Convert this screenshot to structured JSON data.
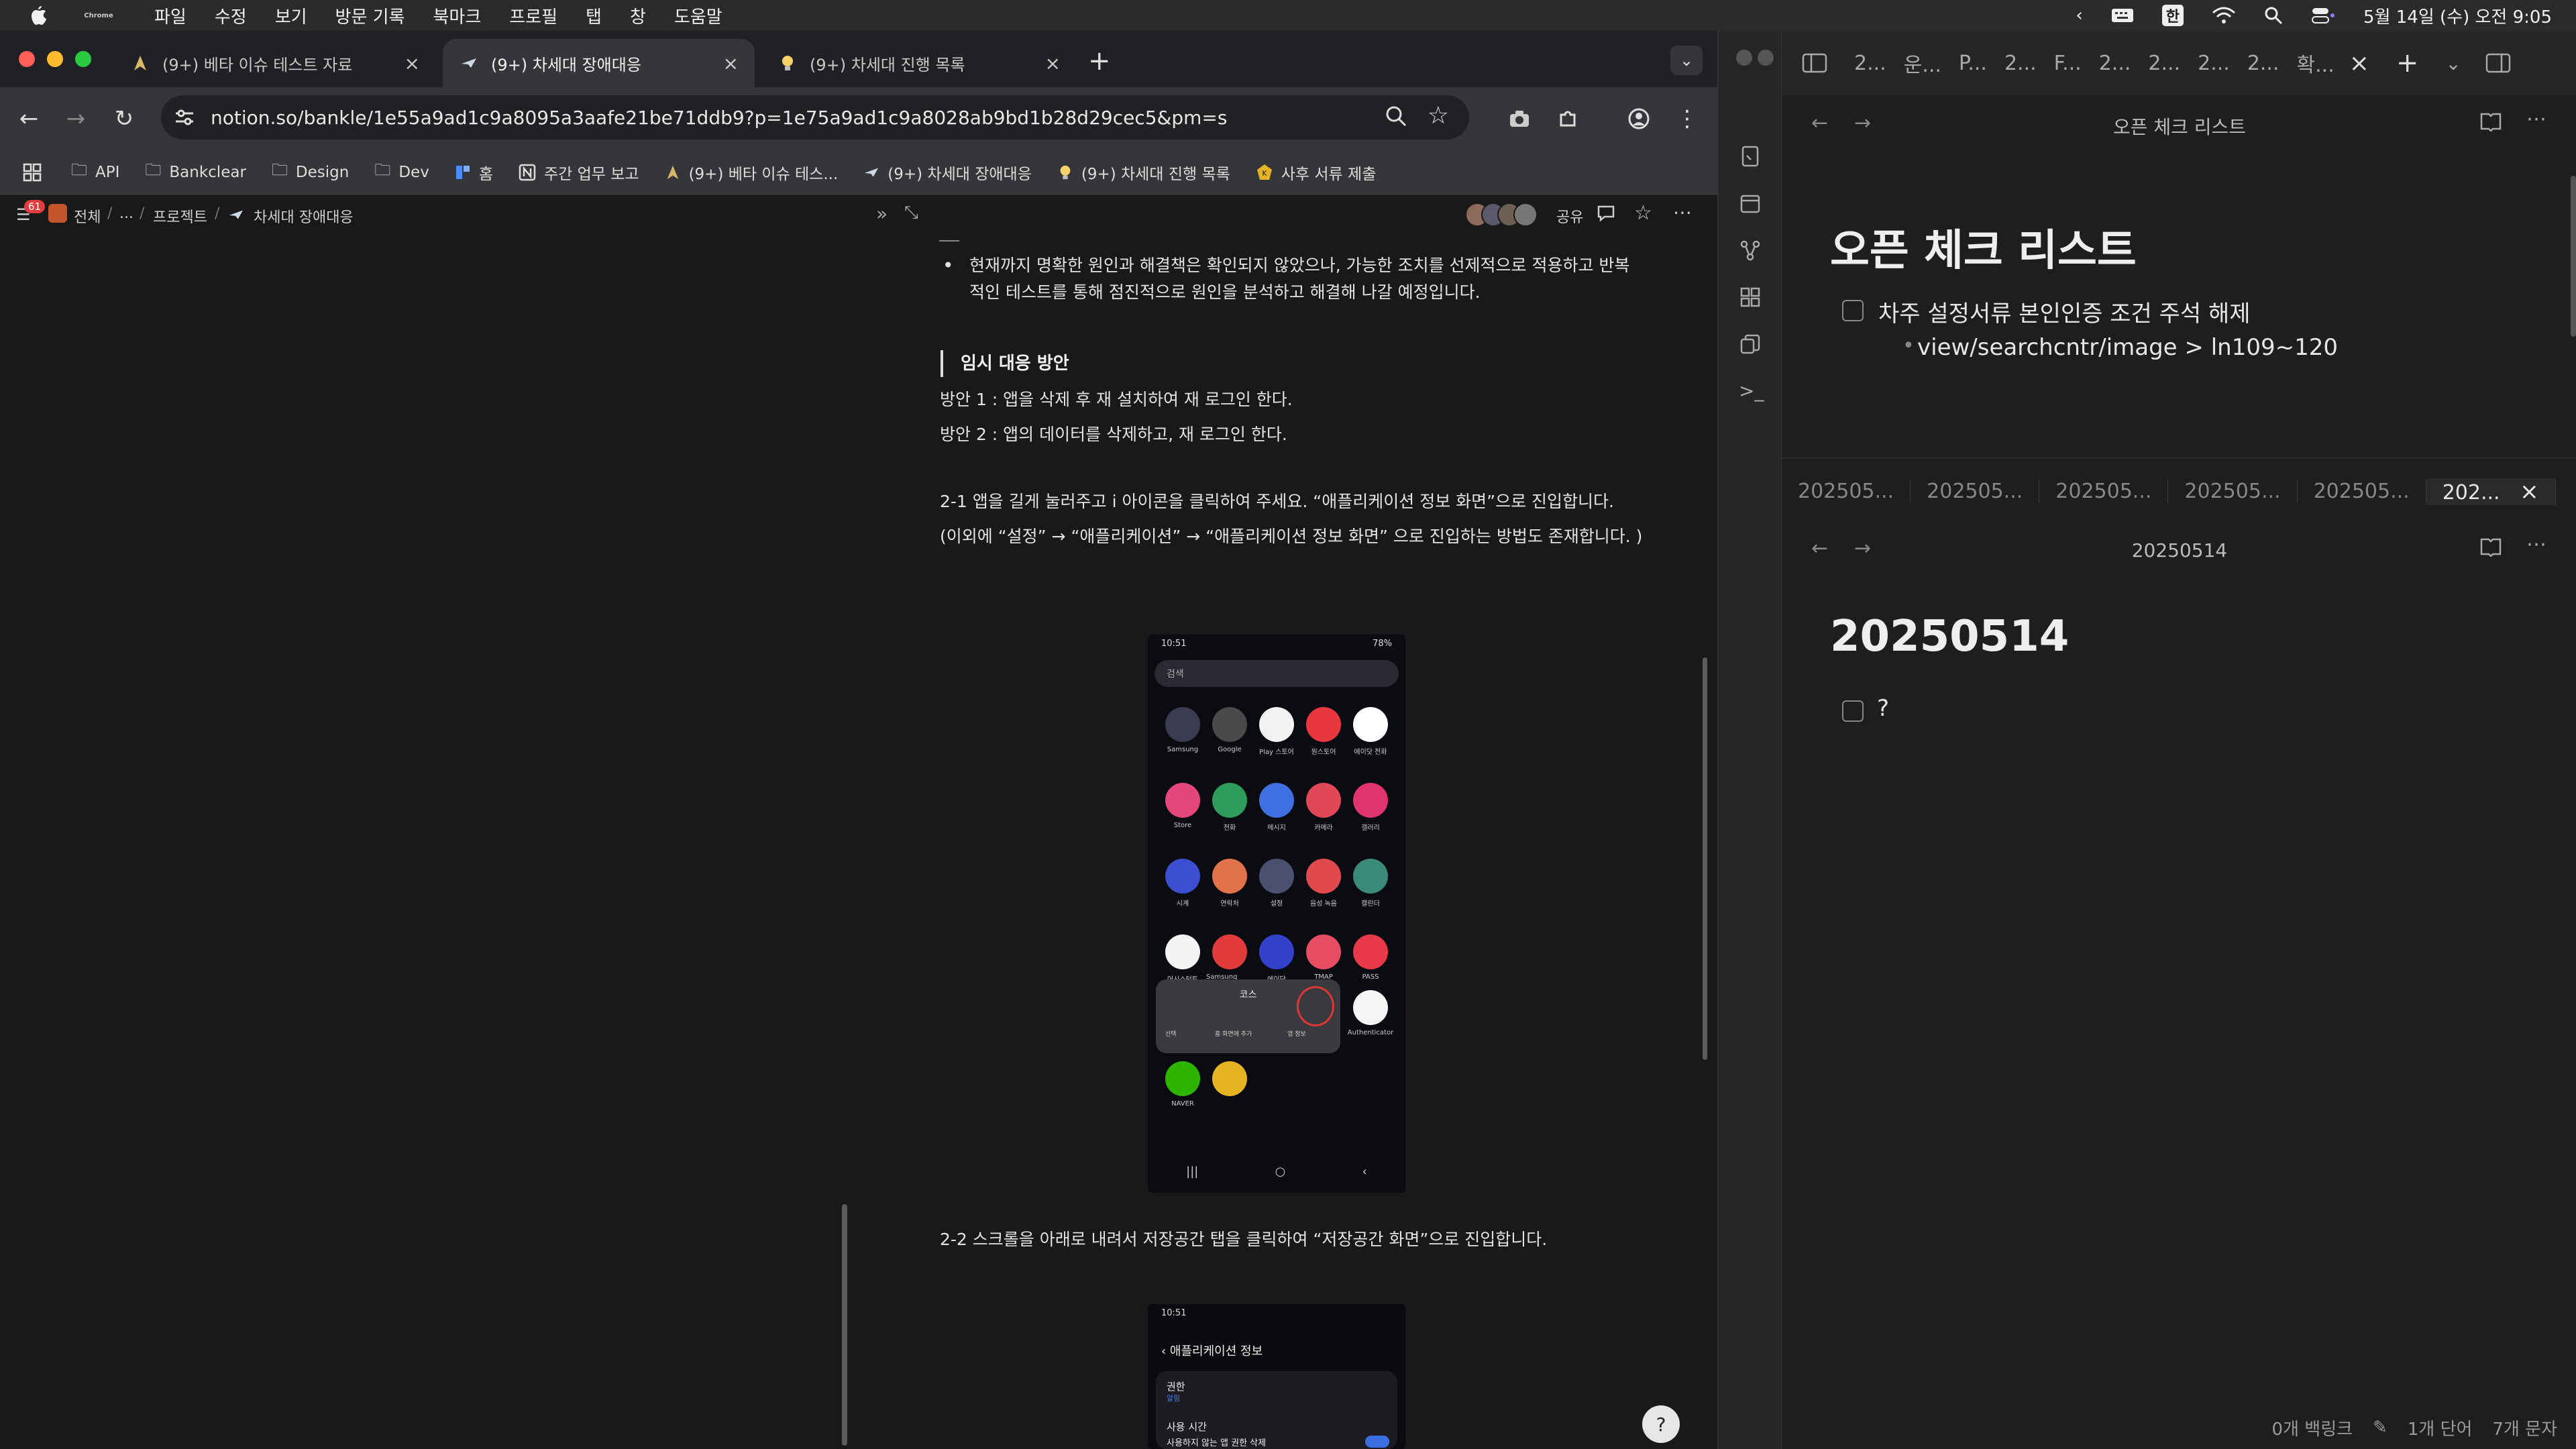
{
  "menubar": {
    "app": "Chrome",
    "items": [
      "파일",
      "수정",
      "보기",
      "방문 기록",
      "북마크",
      "프로필",
      "탭",
      "창",
      "도움말"
    ],
    "ime": "한",
    "datetime": "5월 14일 (수) 오전 9:05"
  },
  "chrome": {
    "tabs": [
      {
        "label": "(9+) 베타 이슈 테스트 자료",
        "icon": "person-icon",
        "active": false
      },
      {
        "label": "(9+) 차세대 장애대응",
        "icon": "plane-icon",
        "active": true
      },
      {
        "label": "(9+) 차세대 진행 목록",
        "icon": "bulb-icon",
        "active": false
      }
    ],
    "url": "notion.so/bankle/1e55a9ad1c9a8095a3aafe21be71ddb9?p=1e75a9ad1c9a8028ab9bd1b28d29cec5&pm=s",
    "bookmarks": [
      {
        "label": "API",
        "icon": "folder-icon"
      },
      {
        "label": "Bankclear",
        "icon": "folder-icon"
      },
      {
        "label": "Design",
        "icon": "folder-icon"
      },
      {
        "label": "Dev",
        "icon": "folder-icon"
      },
      {
        "label": "홈",
        "icon": "notion-blue-icon"
      },
      {
        "label": "주간 업무 보고",
        "icon": "notion-icon"
      },
      {
        "label": "(9+) 베타 이슈 테스...",
        "icon": "person-icon"
      },
      {
        "label": "(9+) 차세대 장애대응",
        "icon": "plane-icon"
      },
      {
        "label": "(9+) 차세대 진행 목록",
        "icon": "bulb-icon"
      },
      {
        "label": "사후 서류 제출",
        "icon": "badge-icon"
      }
    ]
  },
  "notion": {
    "breadcrumb": {
      "badge": "61",
      "items": [
        "전체",
        "...",
        "프로젝트",
        "차세대 장애대응"
      ]
    },
    "share_label": "공유",
    "bullet": "현재까지 명확한 원인과 해결책은 확인되지 않았으나, 가능한 조치를 선제적으로 적용하고 반복적인 테스트를 통해 점진적으로 원인을 분석하고 해결해 나갈 예정입니다.",
    "heading": "임시 대응 방안",
    "plan1": "방안 1 : 앱을 삭제 후 재 설치하여 재 로그인 한다.",
    "plan2": "방안 2 : 앱의 데이터를 삭제하고, 재 로그인 한다.",
    "step1": "2-1 앱을 길게 눌러주고 i 아이콘을 클릭하여 주세요. “애플리케이션 정보 화면”으로 진입합니다.",
    "step1b": "(이외에  “설정” → “애플리케이션” → “애플리케이션 정보 화면” 으로 진입하는 방법도 존재합니다. )",
    "step2": "2-2 스크롤을 아래로 내려서 저장공간 탭을 클릭하여 “저장공간 화면”으로 진입합니다.",
    "phone1": {
      "status_time": "10:51",
      "battery": "78%",
      "search": "검색",
      "apps": [
        "Samsung",
        "Google",
        "Play 스토어",
        "원스토어",
        "에이닷 전화",
        "Store",
        "전화",
        "메시지",
        "카메라",
        "갤러리",
        "시계",
        "연락처",
        "설정",
        "음성 녹음",
        "캘린더",
        "어시스턴트",
        "Samsung Free",
        "에이닷",
        "TMAP",
        "PASS"
      ],
      "popup_title": "코스",
      "popup_actions": [
        "선택",
        "홈 화면에 추가",
        "앱 정보"
      ],
      "extra_apps": [
        "Authenticator",
        "NAVER"
      ]
    },
    "phone2": {
      "status_time": "10:51",
      "title": "애플리케이션 정보",
      "rows": [
        {
          "label": "권한",
          "sub": "알림"
        },
        {
          "label": "사용 시간",
          "sub": ""
        },
        {
          "label": "사용하지 않는 앱 권한 삭제",
          "sub": ""
        }
      ]
    }
  },
  "right": {
    "tabs": [
      "2...",
      "운...",
      "P...",
      "2...",
      "F...",
      "2...",
      "2...",
      "2...",
      "2...",
      "확..."
    ],
    "pane1": {
      "header": "오픈 체크 리스트",
      "title": "오픈 체크 리스트",
      "task": "차주 설정서류 본인인증 조건 주석 해제",
      "sub": "view/searchcntr/image > ln109~120"
    },
    "subtabs": [
      "202505...",
      "202505...",
      "202505...",
      "202505...",
      "202505...",
      "202..."
    ],
    "pane2": {
      "header": "20250514",
      "title": "20250514",
      "task": "?"
    },
    "status": {
      "backlinks": "0개 백링크",
      "words": "1개 단어",
      "chars": "7개 문자"
    }
  }
}
